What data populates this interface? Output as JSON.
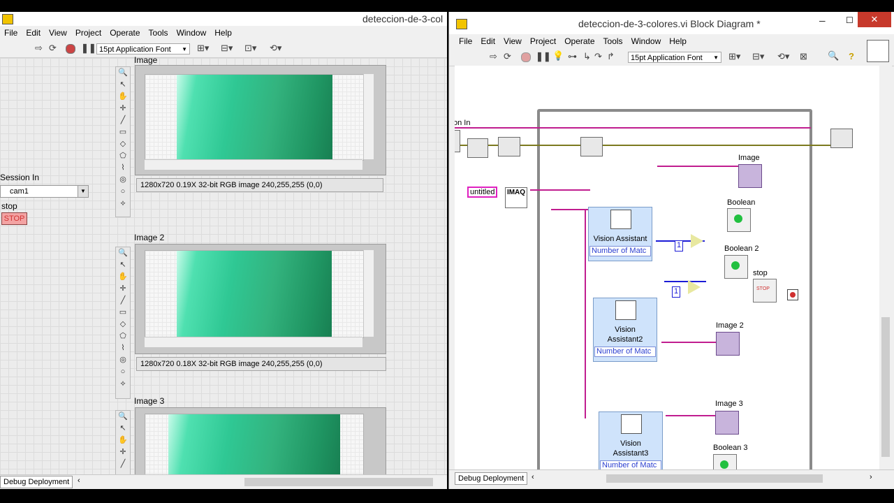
{
  "front_panel": {
    "title": "deteccion-de-3-col",
    "menu": [
      "File",
      "Edit",
      "View",
      "Project",
      "Operate",
      "Tools",
      "Window",
      "Help"
    ],
    "font": "15pt Application Font",
    "image1_label": "Image",
    "image1_info": "1280x720 0.19X 32-bit RGB image 240,255,255    (0,0)",
    "image2_label": "Image 2",
    "image2_info": "1280x720 0.18X 32-bit RGB image 240,255,255    (0,0)",
    "image3_label": "Image 3",
    "session_label": "Session In",
    "session_value": "cam1",
    "stop_label": "stop",
    "stop_button": "STOP",
    "status": "Debug Deployment"
  },
  "block_diagram": {
    "title": "deteccion-de-3-colores.vi Block Diagram *",
    "menu": [
      "File",
      "Edit",
      "View",
      "Project",
      "Operate",
      "Tools",
      "Window",
      "Help"
    ],
    "font": "15pt Application Font",
    "session_label": "on In",
    "untitled": "untitled",
    "imaq": "IMAQ",
    "va1_name": "Vision Assistant",
    "va2_name_line1": "Vision",
    "va2_name_line2": "Assistant2",
    "va3_name_line1": "Vision",
    "va3_name_line2": "Assistant3",
    "num_matches": "Number of Matc",
    "image_label": "Image",
    "image2_label": "Image 2",
    "image3_label": "Image 3",
    "boolean_label": "Boolean",
    "boolean2_label": "Boolean 2",
    "boolean3_label": "Boolean 3",
    "stop_label": "stop",
    "stop_text": "STOP",
    "const1": "1",
    "const2": "1",
    "status": "Debug Deployment"
  },
  "colors": {
    "wire_pink": "#c01d8f",
    "wire_olive": "#7c7a1f",
    "boolean_led": "#22c040",
    "stop_red": "#d03030"
  }
}
